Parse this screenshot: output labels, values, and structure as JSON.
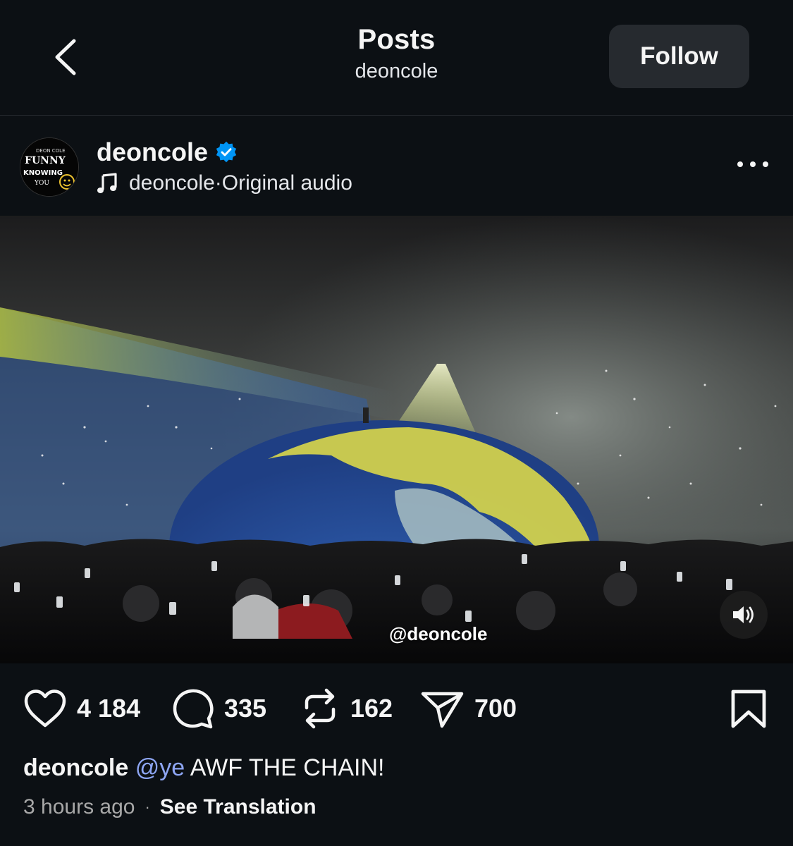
{
  "header": {
    "title": "Posts",
    "subtitle": "deoncole",
    "follow_label": "Follow"
  },
  "post": {
    "username": "deoncole",
    "verified": true,
    "audio_artist": "deoncole",
    "audio_separator": " · ",
    "audio_label": "Original audio",
    "avatar_text": [
      "DEON COLE",
      "FUNNY",
      "KNOWING",
      "YOU"
    ],
    "media_watermark": "@deoncole",
    "likes": "4 184",
    "comments": "335",
    "reposts": "162",
    "shares": "700",
    "caption_user": "deoncole",
    "caption_mention": "@ye",
    "caption_text": " AWF THE CHAIN!",
    "time_ago": "3 hours ago",
    "meta_separator": "·",
    "translate_label": "See Translation"
  },
  "icons": {
    "back": "chevron-left-icon",
    "verified": "verified-badge-icon",
    "music": "music-note-icon",
    "more": "more-horizontal-icon",
    "mute": "speaker-icon",
    "like": "heart-icon",
    "comment": "comment-icon",
    "repost": "repost-icon",
    "share": "send-icon",
    "save": "bookmark-icon"
  },
  "colors": {
    "background": "#0c1014",
    "button": "#262a2f",
    "verified": "#0095f6",
    "mention": "#8ea6f4",
    "muted_text": "#a8a8a8"
  }
}
